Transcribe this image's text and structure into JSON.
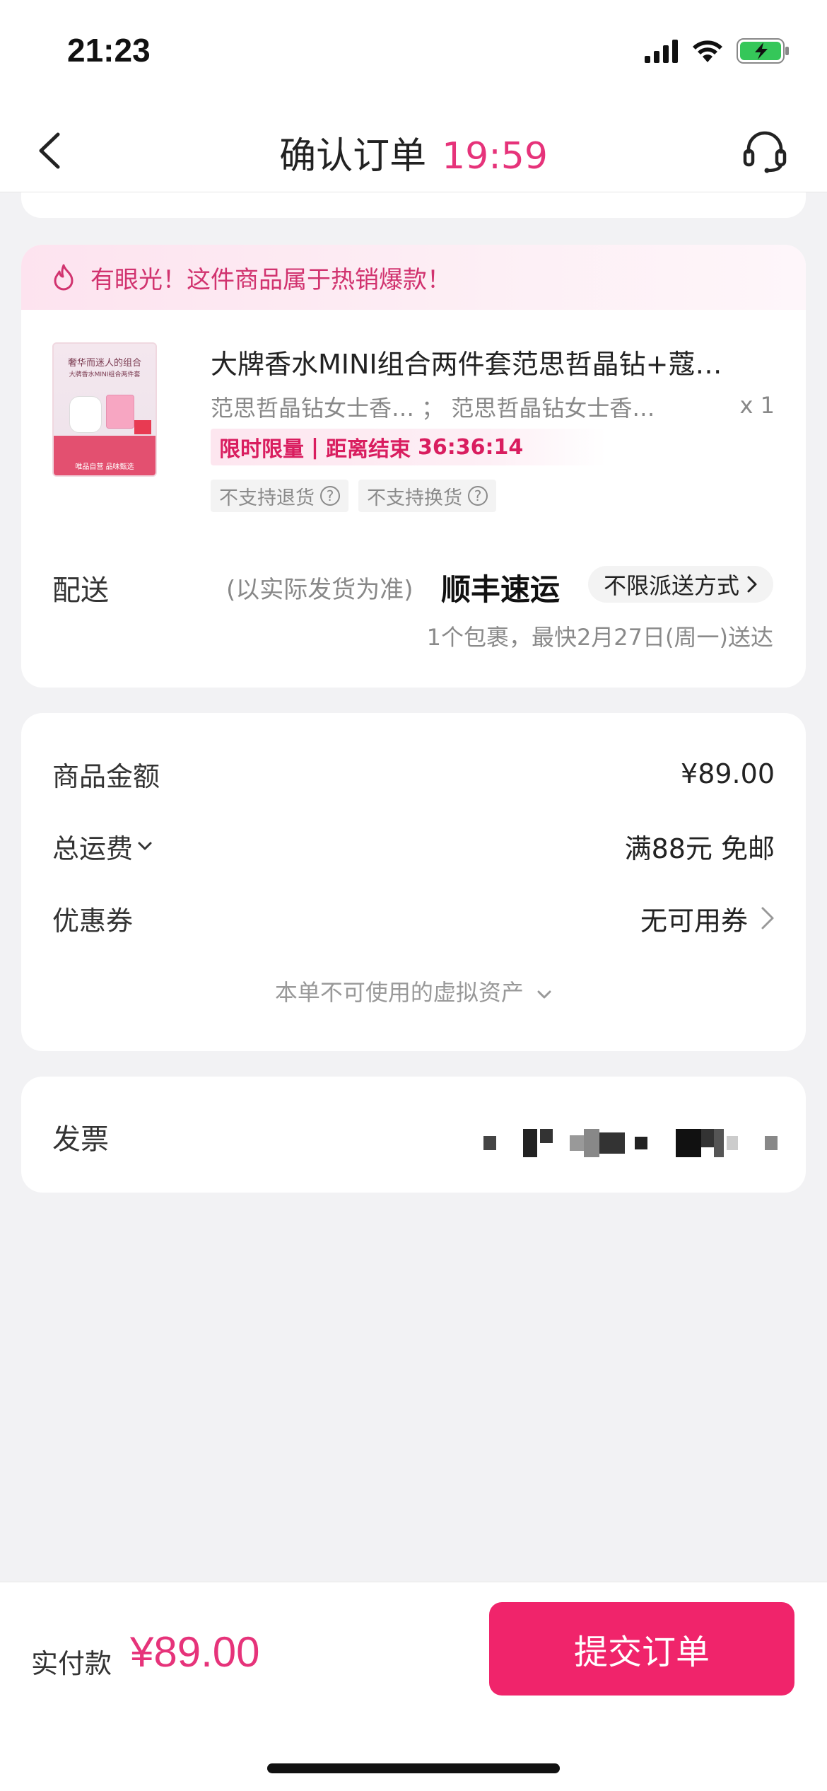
{
  "status_bar": {
    "time": "21:23",
    "icons": [
      "signal-icon",
      "wifi-icon",
      "battery-charging-icon"
    ]
  },
  "nav": {
    "title": "确认订单",
    "countdown": "19:59",
    "back_icon": "chevron-left-icon",
    "support_icon": "headset-icon"
  },
  "banner": {
    "text": "有眼光！这件商品属于热销爆款！",
    "icon": "flame-icon"
  },
  "product": {
    "image_caption_top": "奢华而迷人的组合",
    "image_caption_mid": "大牌香水MINI组合两件套",
    "image_caption_bottom": "唯品自营 品味甄选",
    "title": "大牌香水MINI组合两件套范思哲晶钻+蔻…",
    "spec": "范思哲晶钻女士香… ； 范思哲晶钻女士香…",
    "quantity": "x 1",
    "flash_label": "限时限量",
    "flash_sep": "|",
    "flash_countdown_label": "距离结束",
    "flash_countdown": "36:36:14",
    "policy_tags": [
      "不支持退货",
      "不支持换货"
    ]
  },
  "shipping": {
    "label": "配送",
    "note": "(以实际发货为准)",
    "carrier": "顺丰速运",
    "method": "不限派送方式",
    "eta": "1个包裹，最快2月27日(周一)送达"
  },
  "pricing": {
    "goods_label": "商品金额",
    "goods_value": "¥89.00",
    "freight_label": "总运费",
    "freight_value": "满88元 免邮",
    "coupon_label": "优惠券",
    "coupon_value": "无可用券",
    "virtual_assets": "本单不可使用的虚拟资产"
  },
  "invoice": {
    "label": "发票"
  },
  "bottom": {
    "pay_label": "实付款",
    "pay_amount": "¥89.00",
    "submit_label": "提交订单"
  },
  "colors": {
    "accent": "#f0246b",
    "accent_text": "#e6337a",
    "background": "#f2f2f4"
  }
}
